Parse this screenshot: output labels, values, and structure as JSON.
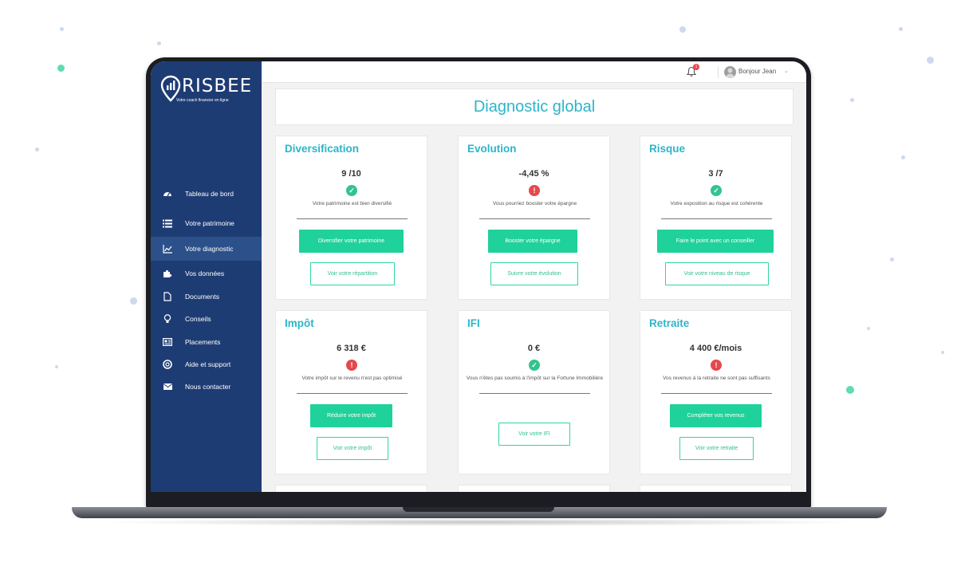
{
  "app": {
    "logo_text": "RISBEE",
    "logo_tagline": "Votre coach financier en ligne"
  },
  "colors": {
    "sidebar": "#1e3c74",
    "sidebar_active": "#2c5089",
    "accent_title": "#2db5c9",
    "button_green": "#1fd19a",
    "ok": "#34c38f",
    "warn": "#e5484d"
  },
  "sidebar": {
    "items": [
      {
        "label": "Tableau de bord",
        "icon": "dashboard-icon",
        "active": false
      },
      {
        "label": "Votre patrimoine",
        "icon": "list-icon",
        "active": false
      },
      {
        "label": "Votre diagnostic",
        "icon": "chart-line-icon",
        "active": true
      },
      {
        "label": "Vos données",
        "icon": "puzzle-icon",
        "active": false
      },
      {
        "label": "Documents",
        "icon": "document-icon",
        "active": false
      },
      {
        "label": "Conseils",
        "icon": "lightbulb-icon",
        "active": false
      },
      {
        "label": "Placements",
        "icon": "newspaper-icon",
        "active": false
      },
      {
        "label": "Aide et support",
        "icon": "lifebuoy-icon",
        "active": false
      },
      {
        "label": "Nous contacter",
        "icon": "envelope-icon",
        "active": false
      }
    ]
  },
  "header": {
    "notification_count": "1",
    "greeting": "Bonjour Jean"
  },
  "main": {
    "title": "Diagnostic global",
    "cards": [
      {
        "title": "Diversification",
        "value": "9 /10",
        "status": "ok",
        "message": "Votre patrimoine est bien diversifié",
        "primary": "Diversifier votre patrimoine",
        "secondary": "Voir votre répartition"
      },
      {
        "title": "Evolution",
        "value": "-4,45 %",
        "status": "warn",
        "message": "Vous pourriez booster votre épargne",
        "primary": "Booster votre épargne",
        "secondary": "Suivre votre évolution"
      },
      {
        "title": "Risque",
        "value": "3 /7",
        "status": "ok",
        "message": "Votre exposition au risque est cohérente",
        "primary": "Faire le point avec un conseiller",
        "secondary": "Voir votre niveau de risque"
      },
      {
        "title": "Impôt",
        "value": "6 318 €",
        "status": "warn",
        "message": "Votre impôt sur le revenu n'est pas optimisé",
        "primary": "Réduire votre impôt",
        "secondary": "Voir votre impôt"
      },
      {
        "title": "IFI",
        "value": "0 €",
        "status": "ok",
        "message": "Vous n'êtes pas soumis à l'impôt sur la Fortune Immobilière",
        "primary": "",
        "secondary": "Voir votre IFI"
      },
      {
        "title": "Retraite",
        "value": "4 400 €/mois",
        "status": "warn",
        "message": "Vos revenus à la retraite ne sont pas suffisants",
        "primary": "Compléter vos revenus",
        "secondary": "Voir votre retraite"
      }
    ]
  }
}
